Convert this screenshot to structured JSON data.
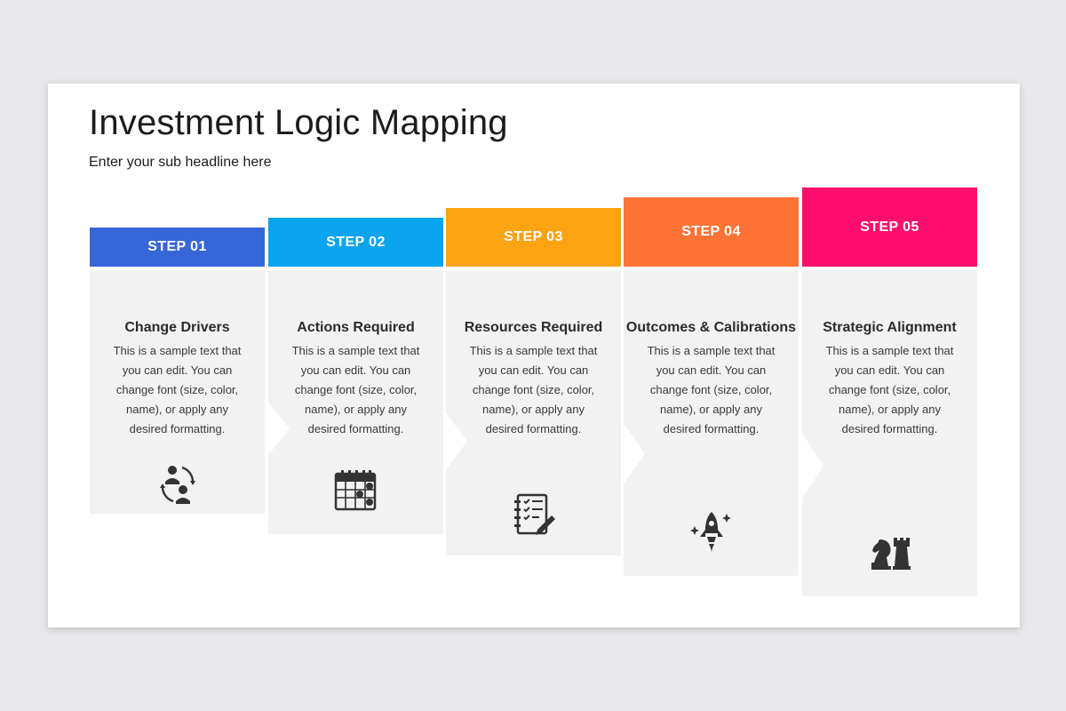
{
  "slide": {
    "title": "Investment Logic Mapping",
    "subtitle": "Enter your sub headline here"
  },
  "steps": [
    {
      "label": "STEP 01",
      "color": "#3766d8",
      "heading": "Change Drivers",
      "text": "This is a sample text that you can edit.  You can change font (size, color, name), or apply any desired formatting.",
      "icon": "people-cycle-icon"
    },
    {
      "label": "STEP 02",
      "color": "#0ba4ef",
      "heading": "Actions Required",
      "text": "This is a sample text that you can edit.  You can change font (size, color, name), or apply any desired formatting.",
      "icon": "calendar-check-icon"
    },
    {
      "label": "STEP 03",
      "color": "#fca312",
      "heading": "Resources Required",
      "text": "This is a sample text that you can edit.  You can change font (size, color, name), or apply any desired formatting.",
      "icon": "checklist-notebook-icon"
    },
    {
      "label": "STEP 04",
      "color": "#fe7335",
      "heading": "Outcomes & Calibrations",
      "text": "This is a sample text that you can edit.  You can change font (size, color, name), or apply any desired formatting.",
      "icon": "rocket-icon"
    },
    {
      "label": "STEP 05",
      "color": "#ff0f6d",
      "heading": "Strategic Alignment",
      "text": "This is a sample text that you can edit.  You can change font (size, color, name), or apply any desired formatting.",
      "icon": "chess-pieces-icon"
    }
  ]
}
